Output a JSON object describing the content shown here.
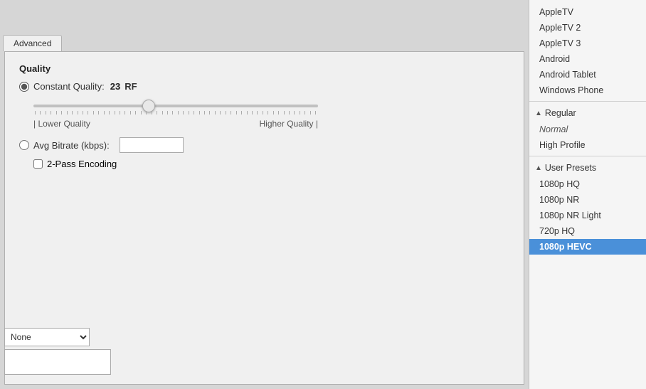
{
  "tabs": {
    "advanced_label": "Advanced"
  },
  "quality": {
    "section_title": "Quality",
    "constant_quality_label": "Constant Quality:",
    "rf_value": "23",
    "rf_unit": "RF",
    "lower_quality_label": "| Lower Quality",
    "higher_quality_label": "Higher Quality |",
    "slider_value": 40,
    "avg_bitrate_label": "Avg Bitrate (kbps):",
    "two_pass_label": "2-Pass Encoding"
  },
  "dropdown": {
    "selected": "None"
  },
  "presets": {
    "items_top": [
      {
        "label": "AppleTV",
        "selected": false
      },
      {
        "label": "AppleTV 2",
        "selected": false
      },
      {
        "label": "AppleTV 3",
        "selected": false
      },
      {
        "label": "Android",
        "selected": false
      },
      {
        "label": "Android Tablet",
        "selected": false
      },
      {
        "label": "Windows Phone",
        "selected": false
      }
    ],
    "group_regular": {
      "label": "Regular",
      "chevron": "▲",
      "items": [
        {
          "label": "Normal",
          "italic": true,
          "selected": false
        },
        {
          "label": "High Profile",
          "selected": false
        }
      ]
    },
    "group_user": {
      "label": "User Presets",
      "chevron": "▲",
      "items": [
        {
          "label": "1080p HQ",
          "selected": false
        },
        {
          "label": "1080p NR",
          "selected": false
        },
        {
          "label": "1080p NR Light",
          "selected": false
        },
        {
          "label": "720p HQ",
          "selected": false
        },
        {
          "label": "1080p HEVC",
          "selected": true
        }
      ]
    }
  }
}
